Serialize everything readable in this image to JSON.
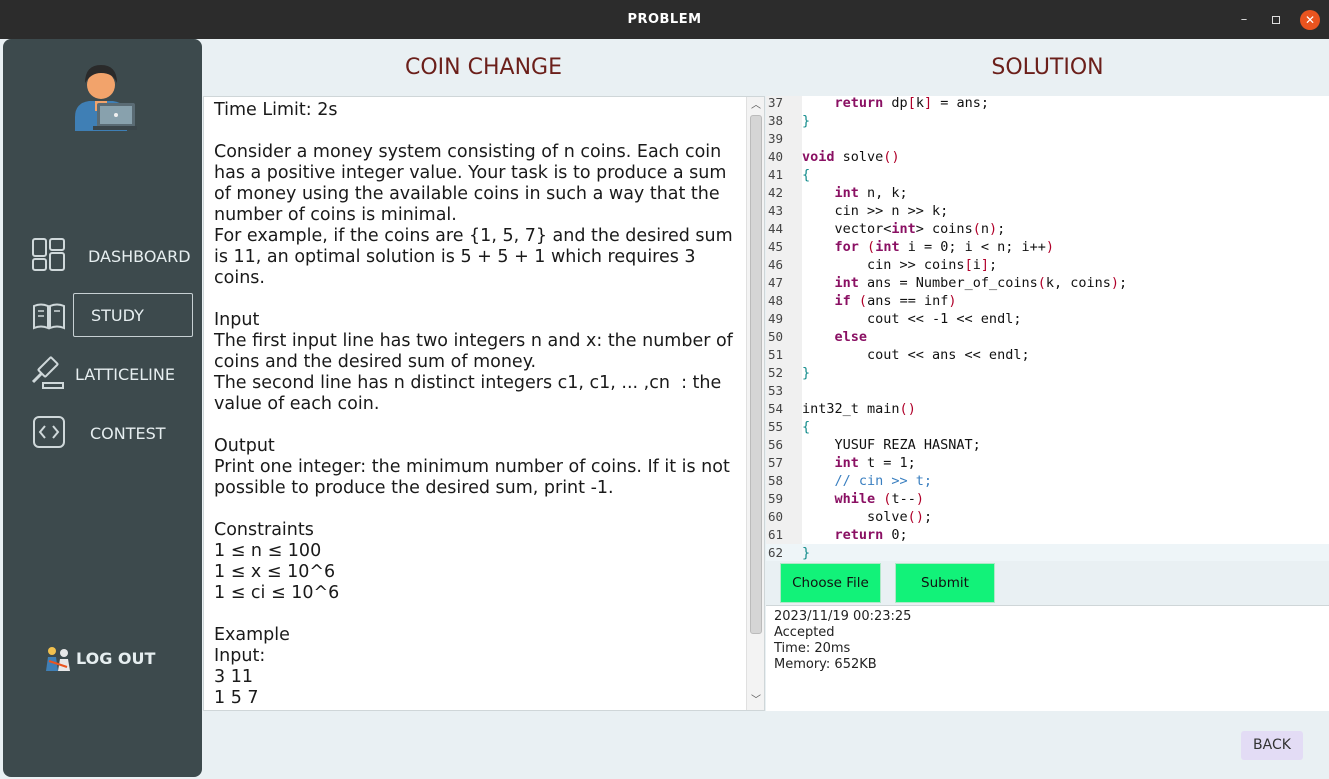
{
  "window": {
    "title": "PROBLEM",
    "minimize_glyph": "–",
    "close_glyph": "✕"
  },
  "sidebar": {
    "items": [
      {
        "label": "DASHBOARD",
        "icon": "dashboard-grid-icon"
      },
      {
        "label": "STUDY",
        "icon": "book-icon"
      },
      {
        "label": "LATTICELINE",
        "icon": "gavel-icon"
      },
      {
        "label": "CONTEST",
        "icon": "code-brackets-icon"
      }
    ],
    "active": "STUDY",
    "logout_label": "LOG OUT"
  },
  "problem": {
    "title": "COIN CHANGE",
    "text": "Time Limit: 2s\n\nConsider a money system consisting of n coins. Each coin has a positive integer value. Your task is to produce a sum of money using the available coins in such a way that the number of coins is minimal.\nFor example, if the coins are {1, 5, 7} and the desired sum is 11, an optimal solution is 5 + 5 + 1 which requires 3 coins.\n\nInput\nThe first input line has two integers n and x: the number of coins and the desired sum of money.\nThe second line has n distinct integers c1, c1, ... ,cn  : the value of each coin.\n\nOutput\nPrint one integer: the minimum number of coins. If it is not possible to produce the desired sum, print -1.\n\nConstraints\n1 ≤ n ≤ 100\n1 ≤ x ≤ 10^6\n1 ≤ ci ≤ 10^6\n\nExample\nInput:\n3 11\n1 5 7"
  },
  "solution": {
    "title": "SOLUTION",
    "code_lines": [
      {
        "n": "37",
        "t": "    return dp[k] = ans;"
      },
      {
        "n": "38",
        "t": "}"
      },
      {
        "n": "39",
        "t": ""
      },
      {
        "n": "40",
        "t": "void solve()"
      },
      {
        "n": "41",
        "t": "{"
      },
      {
        "n": "42",
        "t": "    int n, k;"
      },
      {
        "n": "43",
        "t": "    cin >> n >> k;"
      },
      {
        "n": "44",
        "t": "    vector<int> coins(n);"
      },
      {
        "n": "45",
        "t": "    for (int i = 0; i < n; i++)"
      },
      {
        "n": "46",
        "t": "        cin >> coins[i];"
      },
      {
        "n": "47",
        "t": "    int ans = Number_of_coins(k, coins);"
      },
      {
        "n": "48",
        "t": "    if (ans == inf)"
      },
      {
        "n": "49",
        "t": "        cout << -1 << endl;"
      },
      {
        "n": "50",
        "t": "    else"
      },
      {
        "n": "51",
        "t": "        cout << ans << endl;"
      },
      {
        "n": "52",
        "t": "}"
      },
      {
        "n": "53",
        "t": ""
      },
      {
        "n": "54",
        "t": "int32_t main()"
      },
      {
        "n": "55",
        "t": "{"
      },
      {
        "n": "56",
        "t": "    YUSUF REZA HASNAT;"
      },
      {
        "n": "57",
        "t": "    int t = 1;"
      },
      {
        "n": "58",
        "t": "    // cin >> t;"
      },
      {
        "n": "59",
        "t": "    while (t--)"
      },
      {
        "n": "60",
        "t": "        solve();"
      },
      {
        "n": "61",
        "t": "    return 0;"
      },
      {
        "n": "62",
        "t": "}"
      }
    ],
    "choose_file_label": "Choose File",
    "submit_label": "Submit",
    "result": {
      "timestamp": "2023/11/19 00:23:25",
      "verdict": "Accepted",
      "time": "Time: 20ms",
      "memory": "Memory: 652KB"
    }
  },
  "back_label": "BACK",
  "colors": {
    "sidebar_bg": "#3d4a4d",
    "content_bg": "#e9f0f3",
    "heading": "#6b1f1a",
    "green_button": "#12f279",
    "back_button": "#e3dcf5",
    "close_button": "#e9541f"
  }
}
